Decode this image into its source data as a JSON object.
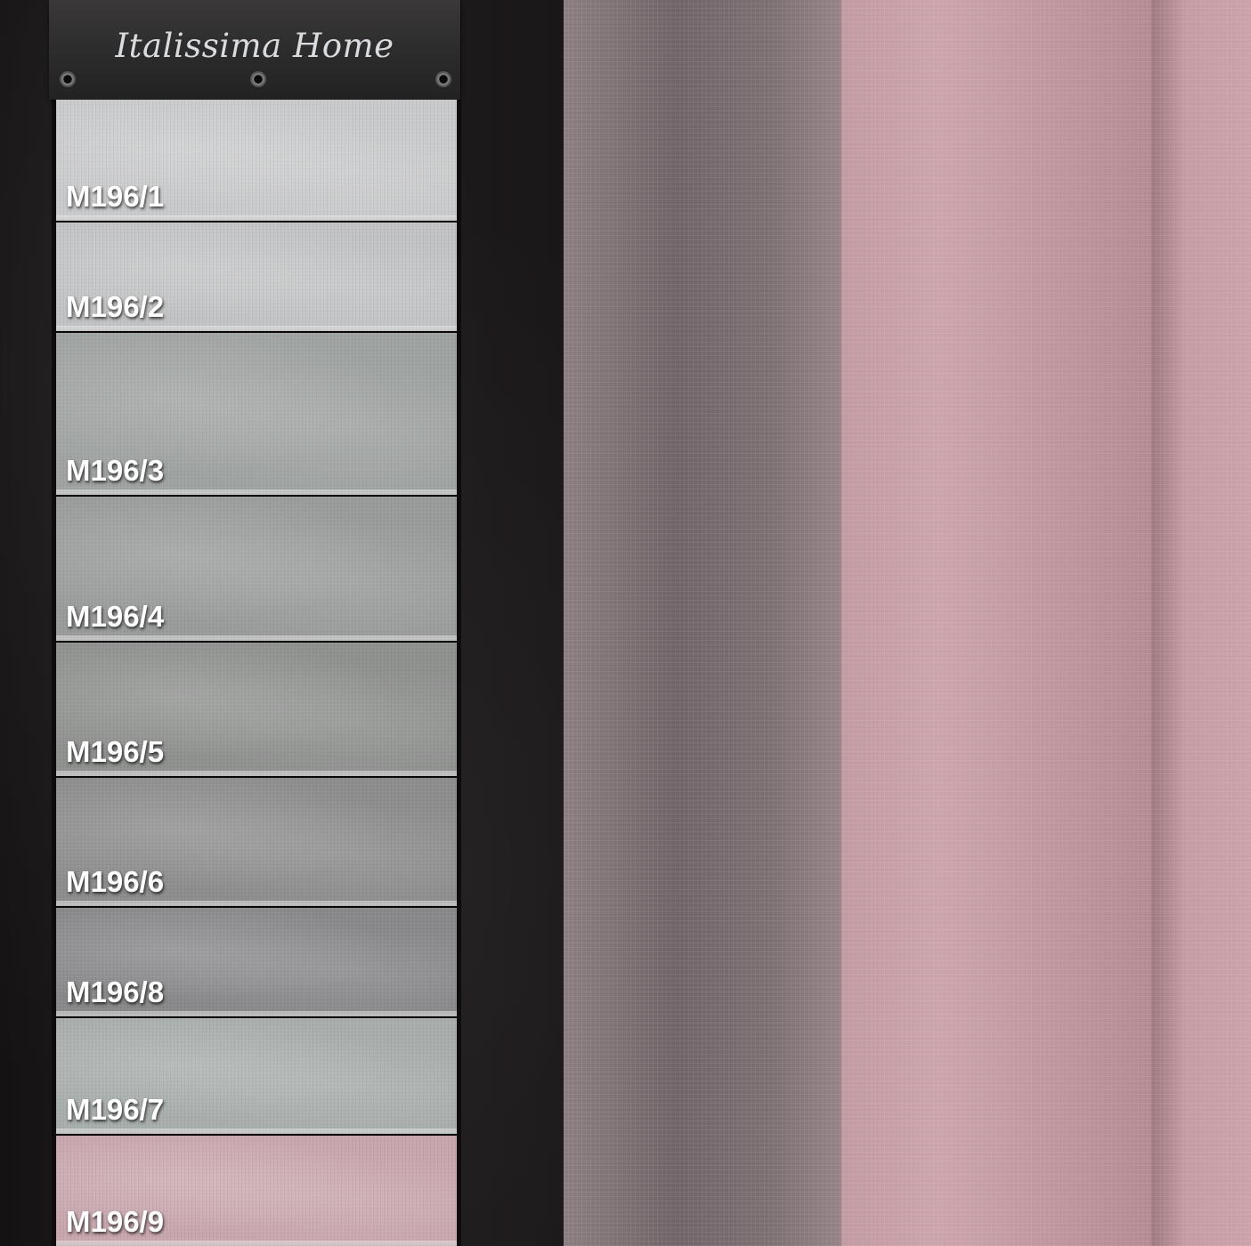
{
  "brand": {
    "name": "Italissima Home"
  },
  "swatches": [
    {
      "code": "M196/1",
      "color": "#c9cacb"
    },
    {
      "code": "M196/2",
      "color": "#c2c3c4"
    },
    {
      "code": "M196/3",
      "color": "#9fa3a2"
    },
    {
      "code": "M196/4",
      "color": "#999c9a"
    },
    {
      "code": "M196/5",
      "color": "#8f918f"
    },
    {
      "code": "M196/6",
      "color": "#8d8d8e"
    },
    {
      "code": "M196/8",
      "color": "#89888a"
    },
    {
      "code": "M196/7",
      "color": "#a8aeab"
    },
    {
      "code": "M196/9",
      "color": "#c8a7ad"
    }
  ],
  "colors": {
    "backdrop": "#1c1a1b",
    "curtain_shadow": "#7b6f72",
    "curtain_light": "#c69da3"
  }
}
